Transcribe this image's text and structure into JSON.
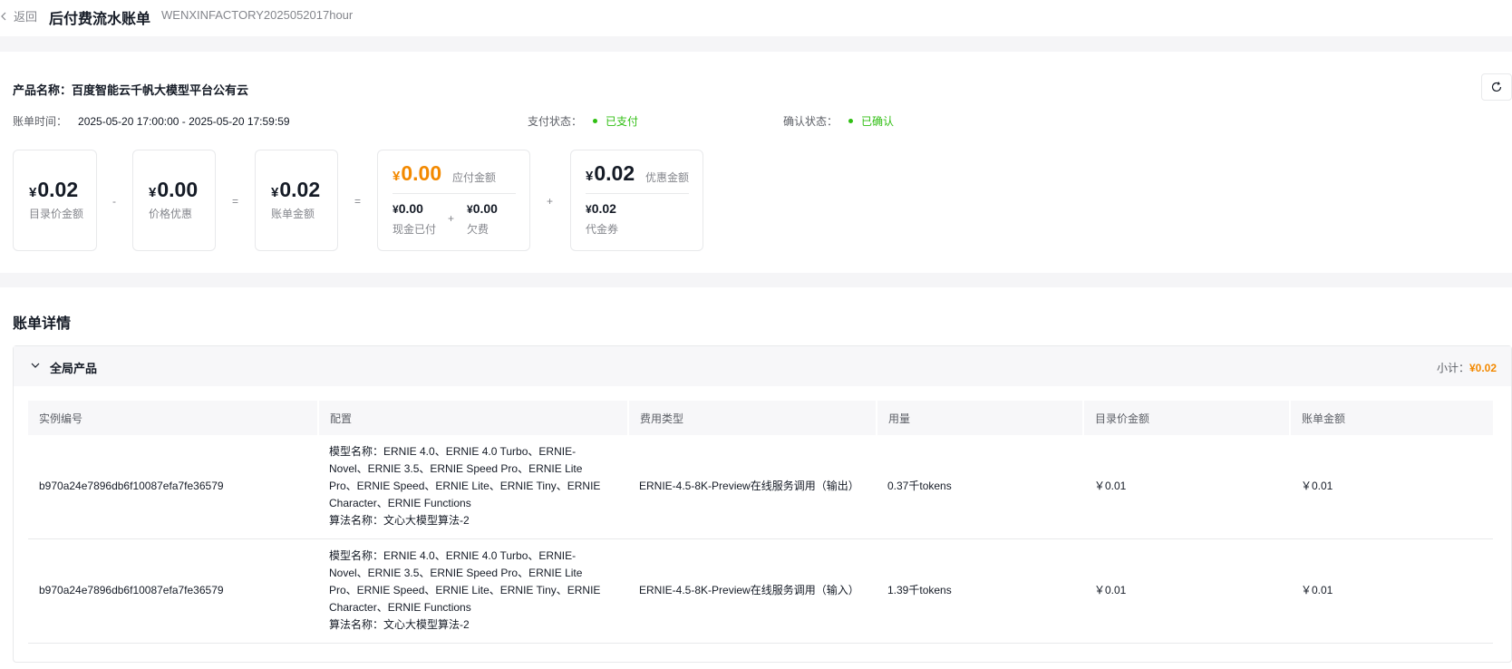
{
  "header": {
    "back_label": "返回",
    "title": "后付费流水账单",
    "bill_id": "WENXINFACTORY2025052017hour"
  },
  "summary": {
    "product_label": "产品名称：",
    "product_name": "百度智能云千帆大模型平台公有云",
    "bill_time_label": "账单时间：",
    "bill_time": "2025-05-20 17:00:00 - 2025-05-20 17:59:59",
    "pay_status_label": "支付状态：",
    "pay_status": "已支付",
    "confirm_status_label": "确认状态：",
    "confirm_status": "已确认",
    "status_color": "#30bf13",
    "yen": "¥",
    "list_price": {
      "amount": "0.02",
      "label": "目录价金额"
    },
    "discount": {
      "amount": "0.00",
      "label": "价格优惠"
    },
    "bill_amount": {
      "amount": "0.02",
      "label": "账单金额"
    },
    "payable": {
      "amount": "0.00",
      "label": "应付金额",
      "color": "#f38900"
    },
    "cash_paid": {
      "amount": "0.00",
      "label": "现金已付"
    },
    "arrears": {
      "amount": "0.00",
      "label": "欠费"
    },
    "promo": {
      "amount": "0.02",
      "label": "优惠金额"
    },
    "voucher": {
      "amount": "0.02",
      "label": "代金券"
    },
    "ops": {
      "minus": "-",
      "eq1": "=",
      "eq2": "=",
      "plus_inner": "+",
      "plus": "+"
    }
  },
  "detail": {
    "title": "账单详情",
    "group": {
      "name": "全局产品",
      "subtotal_label": "小计：",
      "subtotal": "¥0.02"
    },
    "columns": [
      "实例编号",
      "配置",
      "费用类型",
      "用量",
      "目录价金额",
      "账单金额"
    ],
    "rows": [
      {
        "instance": "b970a24e7896db6f10087efa7fe36579",
        "config_model": "模型名称：ERNIE 4.0、ERNIE 4.0 Turbo、ERNIE-Novel、ERNIE 3.5、ERNIE Speed Pro、ERNIE Lite Pro、ERNIE Speed、ERNIE Lite、ERNIE Tiny、ERNIE Character、ERNIE Functions",
        "config_algo": "算法名称：文心大模型算法-2",
        "fee_type": "ERNIE-4.5-8K-Preview在线服务调用（输出）",
        "usage": "0.37千tokens",
        "list_amount": "￥0.01",
        "bill_amount": "￥0.01"
      },
      {
        "instance": "b970a24e7896db6f10087efa7fe36579",
        "config_model": "模型名称：ERNIE 4.0、ERNIE 4.0 Turbo、ERNIE-Novel、ERNIE 3.5、ERNIE Speed Pro、ERNIE Lite Pro、ERNIE Speed、ERNIE Lite、ERNIE Tiny、ERNIE Character、ERNIE Functions",
        "config_algo": "算法名称：文心大模型算法-2",
        "fee_type": "ERNIE-4.5-8K-Preview在线服务调用（输入）",
        "usage": "1.39千tokens",
        "list_amount": "￥0.01",
        "bill_amount": "￥0.01"
      }
    ]
  }
}
